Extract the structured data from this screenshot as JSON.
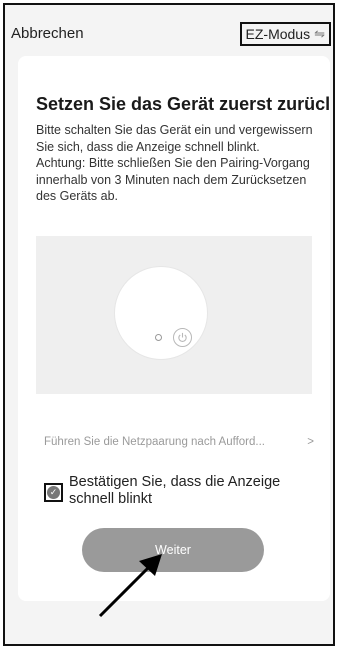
{
  "header": {
    "cancel_label": "Abbrechen",
    "mode_label": "EZ-Modus",
    "mode_icon": "swap-icon"
  },
  "card": {
    "title": "Setzen Sie das Gerät zuerst zurücl",
    "description": "Bitte schalten Sie das Gerät ein und vergewissern Sie sich, dass die Anzeige schnell blinkt.\nAchtung: Bitte schließen Sie den Pairing-Vorgang innerhalb von 3 Minuten nach dem Zurücksetzen des Geräts ab.",
    "pairing_link": "Führen Sie die Netzpaarung nach Aufford...",
    "confirm_label": "Bestätigen Sie, dass die Anzeige schnell blinkt",
    "confirm_checked": true,
    "next_button": "Weiter"
  },
  "colors": {
    "background": "#f4f4f4",
    "card": "#ffffff",
    "button": "#9a9a9a"
  }
}
